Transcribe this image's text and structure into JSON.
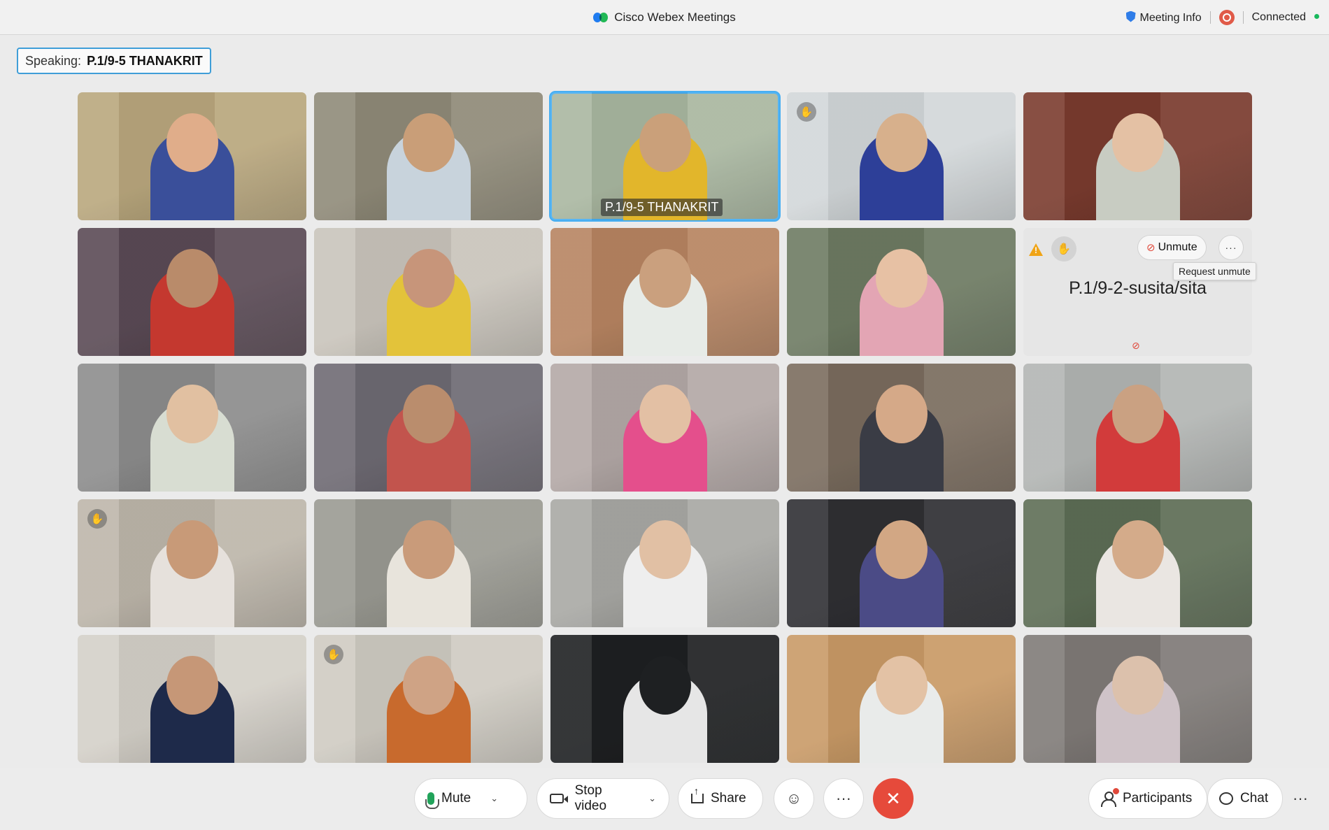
{
  "titlebar": {
    "app_title": "Cisco Webex Meetings",
    "meeting_info": "Meeting Info",
    "connection_status": "Connected"
  },
  "speaking": {
    "label": "Speaking:",
    "name": "P.1/9-5 THANAKRIT"
  },
  "tiles": [
    {
      "label": "",
      "bg": "#b9a77d",
      "fg": "#3a4f9a",
      "skin": "#e0ad8a",
      "hand": false
    },
    {
      "label": "",
      "bg": "#8f8a78",
      "fg": "#c8d3dc",
      "skin": "#c99e78",
      "hand": false
    },
    {
      "label": "P.1/9-5 THANAKRIT",
      "bg": "#a9b7a0",
      "fg": "#e2b62b",
      "skin": "#caa07a",
      "hand": false,
      "active": true
    },
    {
      "label": "",
      "bg": "#d2d7d9",
      "fg": "#2d3f98",
      "skin": "#d7b08c",
      "hand": true
    },
    {
      "label": "",
      "bg": "#7a3b2e",
      "fg": "#c8ccc2",
      "skin": "#e4c1a4",
      "hand": false
    },
    {
      "label": "",
      "bg": "#5a4a55",
      "fg": "#c4382f",
      "skin": "#b98b6a",
      "hand": false
    },
    {
      "label": "",
      "bg": "#c9c4bb",
      "fg": "#e3c33a",
      "skin": "#c7957a",
      "hand": false
    },
    {
      "label": "",
      "bg": "#b78461",
      "fg": "#e7ebe7",
      "skin": "#caa07e",
      "hand": false
    },
    {
      "label": "",
      "bg": "#6d7a62",
      "fg": "#e3a5b4",
      "skin": "#e7c1a4",
      "hand": false
    },
    {
      "label": "P.1/9-2-susita/sita",
      "muted": true
    },
    {
      "label": "",
      "bg": "#8c8c8c",
      "fg": "#d8ddd2",
      "skin": "#e1c0a1",
      "hand": false
    },
    {
      "label": "",
      "bg": "#6e6a73",
      "fg": "#c2544d",
      "skin": "#ba8d6d",
      "hand": false
    },
    {
      "label": "",
      "bg": "#b3a8a6",
      "fg": "#e44f8c",
      "skin": "#e3c0a4",
      "hand": false
    },
    {
      "label": "",
      "bg": "#7a6c5e",
      "fg": "#3a3c45",
      "skin": "#d5a988",
      "hand": false
    },
    {
      "label": "",
      "bg": "#b2b5b3",
      "fg": "#d23b3b",
      "skin": "#caa182",
      "hand": false
    },
    {
      "label": "",
      "bg": "#bdb6aa",
      "fg": "#e6e1dc",
      "skin": "#c89a78",
      "hand": true
    },
    {
      "label": "",
      "bg": "#9a9a92",
      "fg": "#e8e4dc",
      "skin": "#c99b7a",
      "hand": false
    },
    {
      "label": "",
      "bg": "#a8a8a4",
      "fg": "#eeeeee",
      "skin": "#e1c0a4",
      "hand": false
    },
    {
      "label": "",
      "bg": "#2f2f33",
      "fg": "#4b4b86",
      "skin": "#d2a784",
      "hand": false
    },
    {
      "label": "",
      "bg": "#5d6d55",
      "fg": "#eae6e2",
      "skin": "#d4ab8a",
      "hand": false
    },
    {
      "label": "",
      "bg": "#d4d0c8",
      "fg": "#1e2a4a",
      "skin": "#c69777",
      "hand": false
    },
    {
      "label": "",
      "bg": "#cfcbc2",
      "fg": "#c86a2d",
      "skin": "#cfa385",
      "hand": true
    },
    {
      "label": "",
      "bg": "#1e2022",
      "fg": "#e6e6e6",
      "skin": "#1e2022",
      "hand": false
    },
    {
      "label": "",
      "bg": "#c99a66",
      "fg": "#e9ebea",
      "skin": "#e3c2a5",
      "hand": false
    },
    {
      "label": "",
      "bg": "#7f7a77",
      "fg": "#cfc3c8",
      "skin": "#dcc1ac",
      "hand": false
    }
  ],
  "muted_tile": {
    "unmute_label": "Unmute",
    "tooltip": "Request unmute"
  },
  "toolbar": {
    "mute": "Mute",
    "stop_video": "Stop video",
    "share": "Share",
    "participants": "Participants",
    "chat": "Chat"
  },
  "colors": {
    "accent": "#46aef2",
    "end_call": "#e64a3b",
    "connected": "#18b85c"
  }
}
